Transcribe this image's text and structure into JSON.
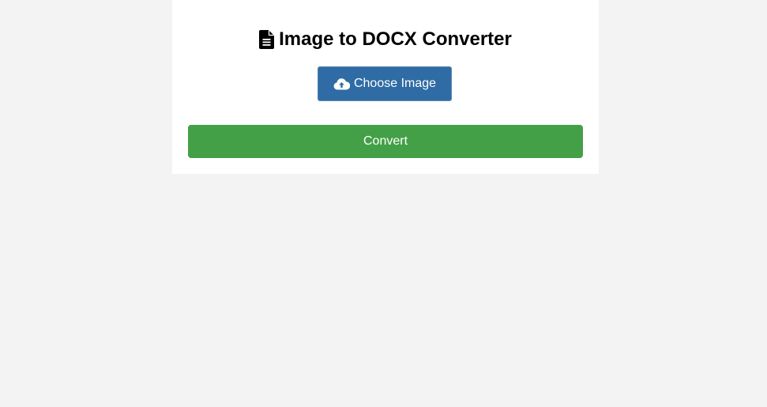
{
  "header": {
    "title": "Image to DOCX Converter",
    "icon": "file-lines-icon"
  },
  "upload": {
    "label": "Choose Image",
    "icon": "cloud-upload-icon",
    "color": "#2f6ca5"
  },
  "actions": {
    "convert_label": "Convert",
    "color": "#43a047"
  },
  "theme": {
    "page_background": "#f3f3f3",
    "card_background": "#ffffff"
  }
}
